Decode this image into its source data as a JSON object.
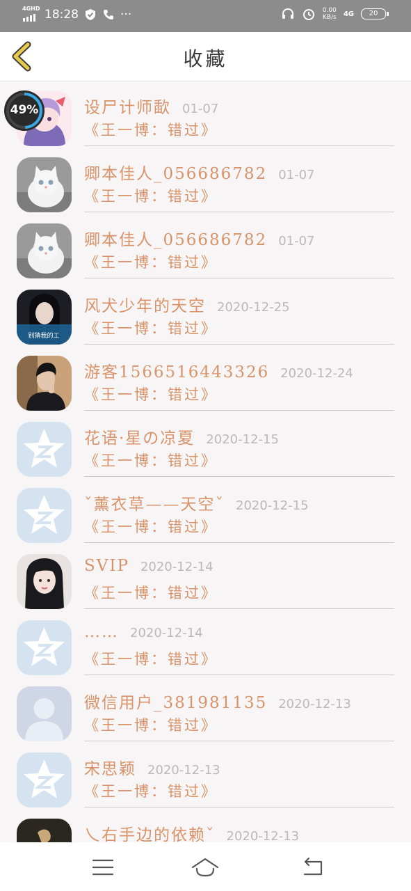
{
  "status_bar": {
    "network": "4GHD",
    "time": "18:28",
    "speed_value": "0.00",
    "speed_unit": "KB/s",
    "signal": "4G",
    "battery": "20",
    "more": "···"
  },
  "header": {
    "title": "收藏"
  },
  "progress_badge": {
    "text": "49%",
    "percent": 49
  },
  "list": [
    {
      "name": "设尸计师歃",
      "date": "01-07",
      "subtitle": "《王一博：错过》",
      "avatar": "anime-girl"
    },
    {
      "name": "卿本佳人_056686782",
      "date": "01-07",
      "subtitle": "《王一博：错过》",
      "avatar": "white-cat"
    },
    {
      "name": "卿本佳人_056686782",
      "date": "01-07",
      "subtitle": "《王一博：错过》",
      "avatar": "white-cat"
    },
    {
      "name": "风犬少年的天空",
      "date": "2020-12-25",
      "subtitle": "《王一博：错过》",
      "avatar": "girl-portrait",
      "avatar_caption": "别猜我的工"
    },
    {
      "name": "游客1566516443326",
      "date": "2020-12-24",
      "subtitle": "《王一博：错过》",
      "avatar": "boy-portrait"
    },
    {
      "name": "花语·星の凉夏",
      "date": "2020-12-15",
      "subtitle": "《王一博：错过》",
      "avatar": "qzone-star"
    },
    {
      "name": "ˇ薰衣草——天空ˇ",
      "date": "2020-12-15",
      "subtitle": "《王一博：错过》",
      "avatar": "qzone-star"
    },
    {
      "name": "SVIP",
      "date": "2020-12-14",
      "subtitle": "《王一博：错过》",
      "avatar": "girl-headshot"
    },
    {
      "name": "……",
      "date": "2020-12-14",
      "subtitle": "《王一博：错过》",
      "avatar": "qzone-star"
    },
    {
      "name": "微信用户_381981135",
      "date": "2020-12-13",
      "subtitle": "《王一博：错过》",
      "avatar": "default-user"
    },
    {
      "name": "宋思颖",
      "date": "2020-12-13",
      "subtitle": "《王一博：错过》",
      "avatar": "qzone-star"
    },
    {
      "name": "乀右手边的依赖ˇ",
      "date": "2020-12-13",
      "subtitle": "",
      "avatar": "dark-photo"
    }
  ],
  "colors": {
    "accent": "#d9936a",
    "date": "#b9b9b9",
    "status_bar": "#8c8c8c",
    "back_arrow": "#e8c94a"
  },
  "nav_bar": {
    "icons": [
      "menu-icon",
      "home-icon",
      "back-icon"
    ]
  }
}
